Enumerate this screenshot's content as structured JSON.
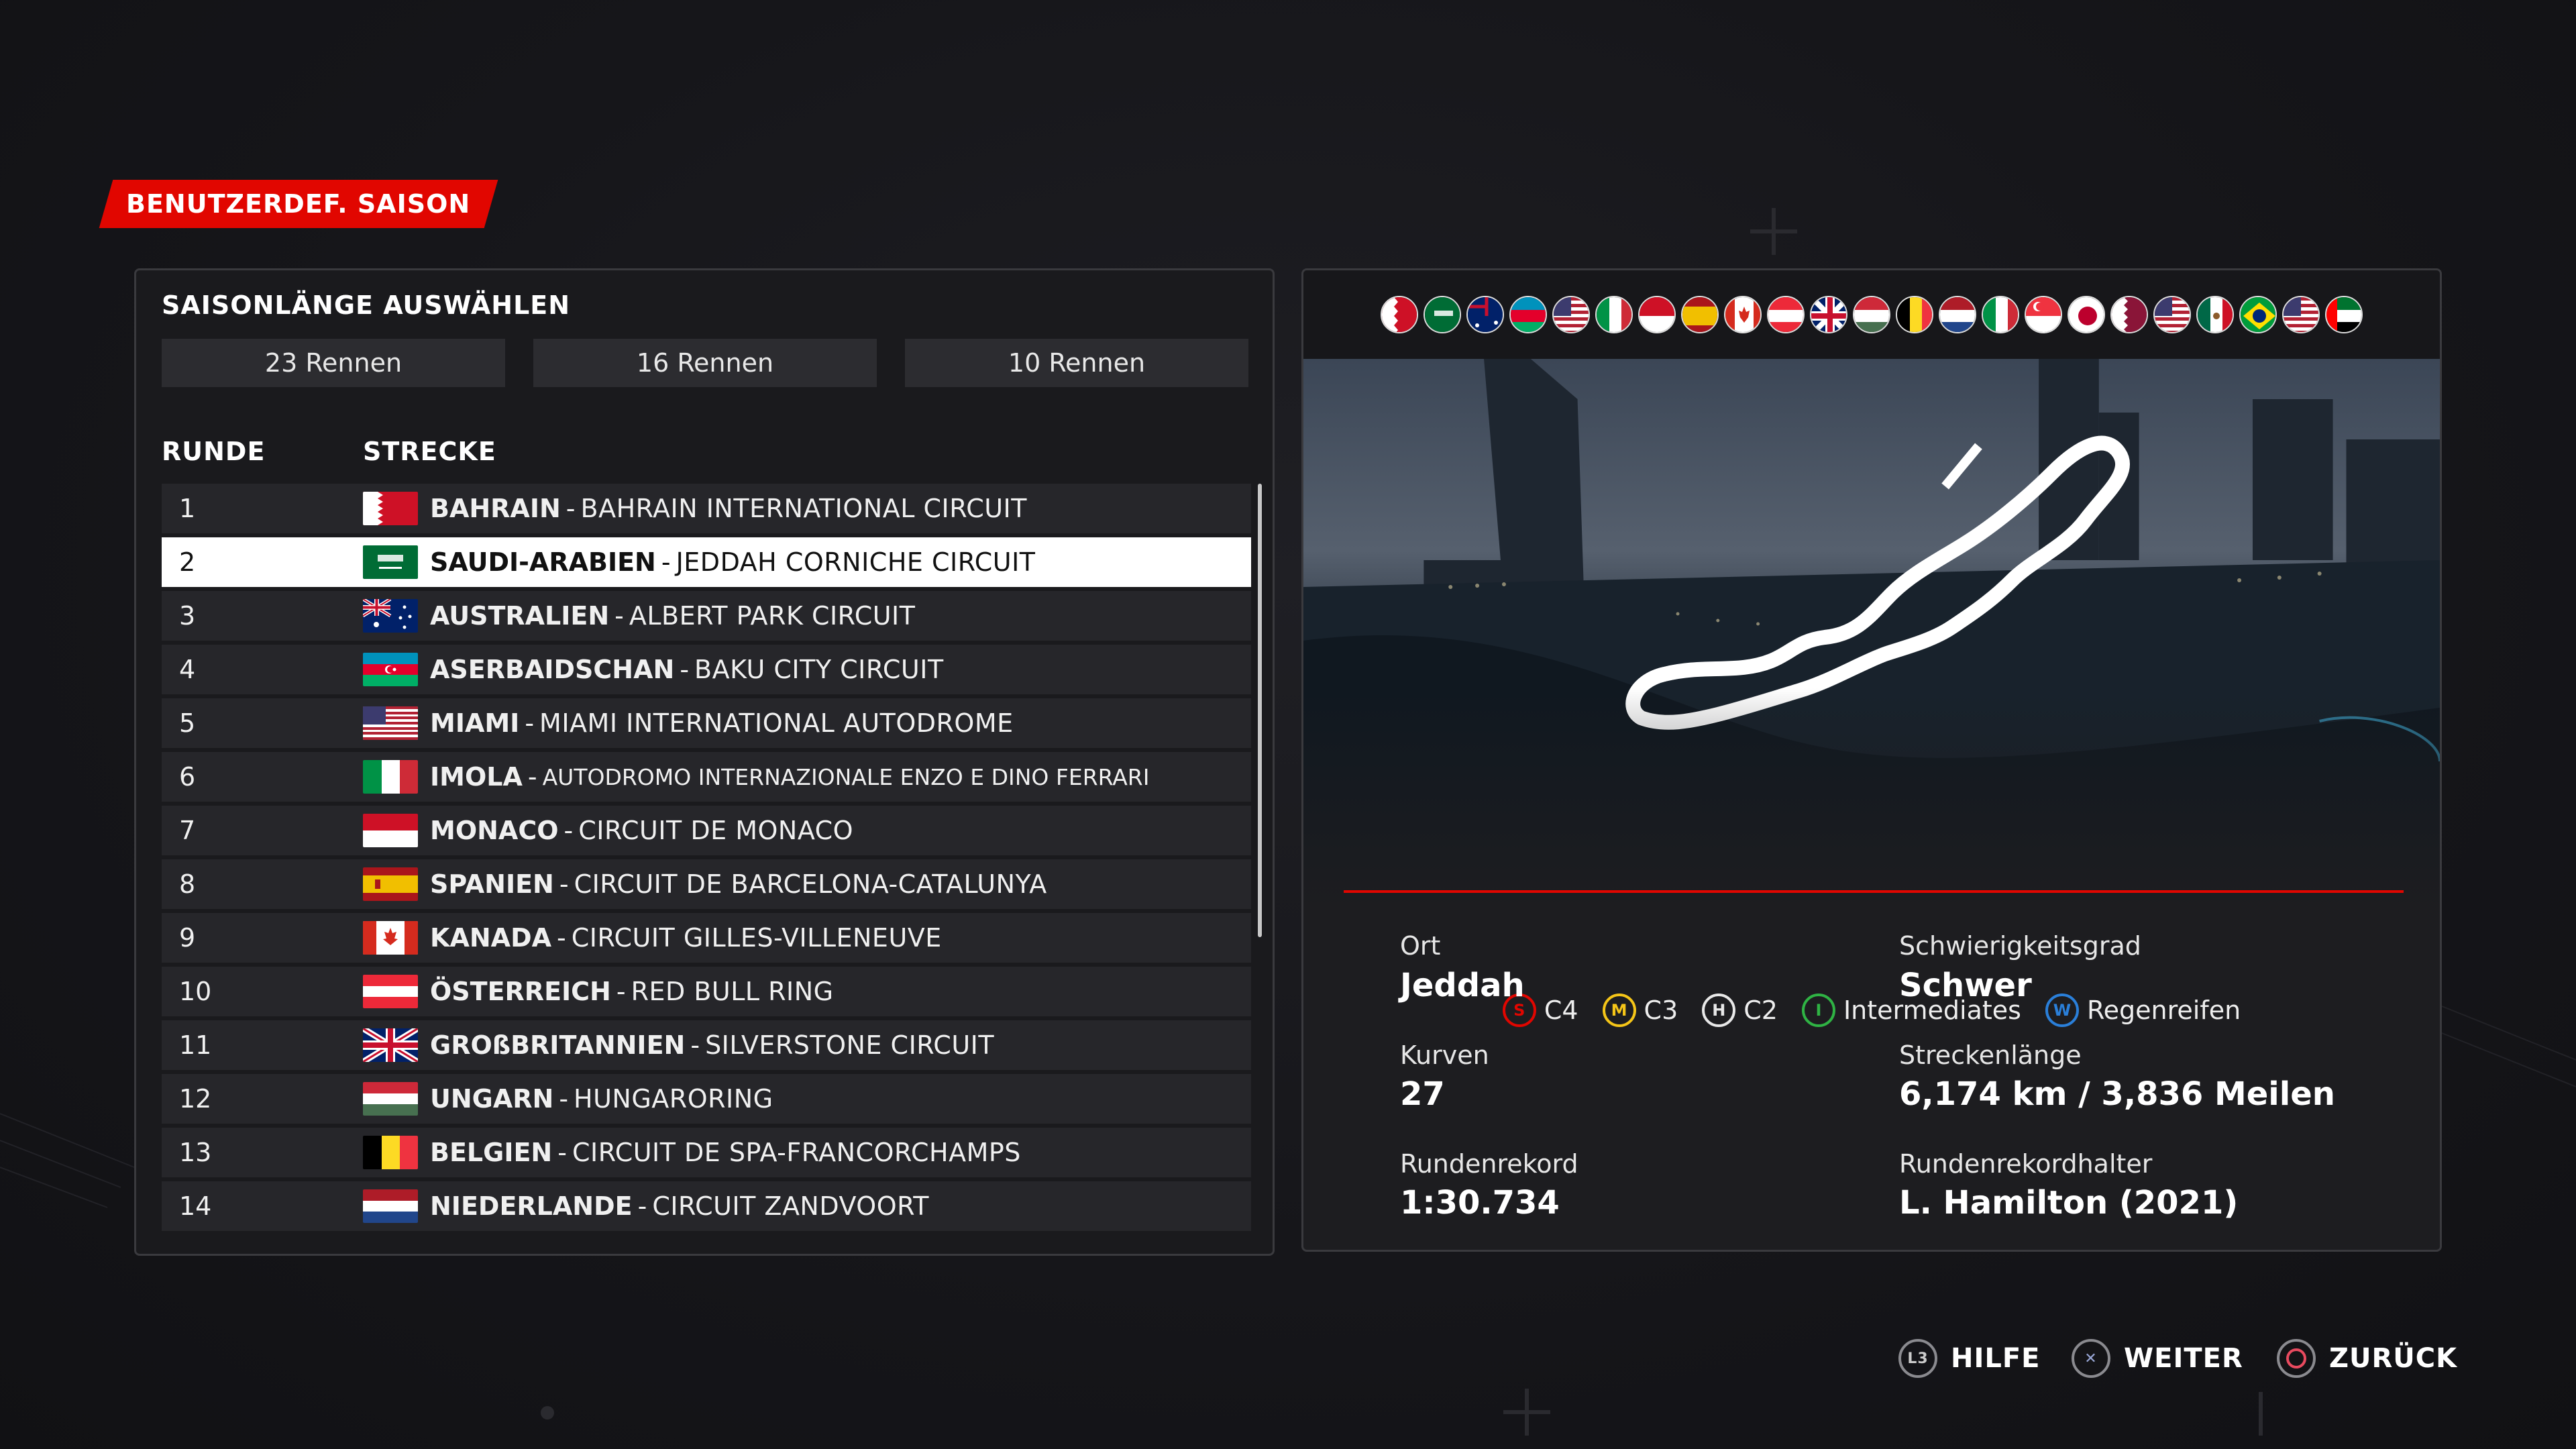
{
  "header": {
    "mode_label": "BENUTZERDEF. SAISON"
  },
  "season_length": {
    "title": "SAISONLÄNGE AUSWÄHLEN",
    "options": [
      "23 Rennen",
      "16 Rennen",
      "10 Rennen"
    ]
  },
  "table": {
    "col_round": "RUNDE",
    "col_track": "STRECKE",
    "rows": [
      {
        "round": "1",
        "country": "BAHRAIN",
        "circuit": "BAHRAIN INTERNATIONAL CIRCUIT",
        "flag": "bahrain-flag"
      },
      {
        "round": "2",
        "country": "SAUDI-ARABIEN",
        "circuit": "JEDDAH CORNICHE CIRCUIT",
        "flag": "saudi-flag"
      },
      {
        "round": "3",
        "country": "AUSTRALIEN",
        "circuit": "ALBERT PARK CIRCUIT",
        "flag": "australia-flag"
      },
      {
        "round": "4",
        "country": "ASERBAIDSCHAN",
        "circuit": "BAKU CITY CIRCUIT",
        "flag": "azerbaijan-flag"
      },
      {
        "round": "5",
        "country": "MIAMI",
        "circuit": "MIAMI INTERNATIONAL AUTODROME",
        "flag": "usa-flag"
      },
      {
        "round": "6",
        "country": "IMOLA",
        "circuit": "AUTODROMO INTERNAZIONALE ENZO E DINO FERRARI",
        "flag": "italy-flag"
      },
      {
        "round": "7",
        "country": "MONACO",
        "circuit": "CIRCUIT DE MONACO",
        "flag": "monaco-flag"
      },
      {
        "round": "8",
        "country": "SPANIEN",
        "circuit": "CIRCUIT DE BARCELONA-CATALUNYA",
        "flag": "spain-flag"
      },
      {
        "round": "9",
        "country": "KANADA",
        "circuit": "CIRCUIT GILLES-VILLENEUVE",
        "flag": "canada-flag"
      },
      {
        "round": "10",
        "country": "ÖSTERREICH",
        "circuit": "RED BULL RING",
        "flag": "austria-flag"
      },
      {
        "round": "11",
        "country": "GROßBRITANNIEN",
        "circuit": "SILVERSTONE CIRCUIT",
        "flag": "uk-flag"
      },
      {
        "round": "12",
        "country": "UNGARN",
        "circuit": "HUNGARORING",
        "flag": "hungary-flag"
      },
      {
        "round": "13",
        "country": "BELGIEN",
        "circuit": "CIRCUIT DE SPA-FRANCORCHAMPS",
        "flag": "belgium-flag"
      },
      {
        "round": "14",
        "country": "NIEDERLANDE",
        "circuit": "CIRCUIT ZANDVOORT",
        "flag": "netherlands-flag"
      }
    ]
  },
  "tyres": [
    {
      "letter": "S",
      "label": "C4",
      "color": "#e10600"
    },
    {
      "letter": "M",
      "label": "C3",
      "color": "#f5c518"
    },
    {
      "letter": "H",
      "label": "C2",
      "color": "#e8e8e8"
    },
    {
      "letter": "I",
      "label": "Intermediates",
      "color": "#2fb344"
    },
    {
      "letter": "W",
      "label": "Regenreifen",
      "color": "#2a7fd9"
    }
  ],
  "info": {
    "location_label": "Ort",
    "location_value": "Jeddah",
    "difficulty_label": "Schwierigkeitsgrad",
    "difficulty_value": "Schwer",
    "turns_label": "Kurven",
    "turns_value": "27",
    "length_label": "Streckenlänge",
    "length_value": "6,174 km / 3,836 Meilen",
    "record_label": "Rundenrekord",
    "record_value": "1:30.734",
    "record_holder_label": "Rundenrekordhalter",
    "record_holder_value": "L. Hamilton (2021)"
  },
  "footer": {
    "help": "HILFE",
    "continue": "WEITER",
    "back": "ZURÜCK"
  },
  "colors": {
    "accent": "#e10600",
    "panel": "#1a1a1d",
    "row": "#26262a"
  }
}
